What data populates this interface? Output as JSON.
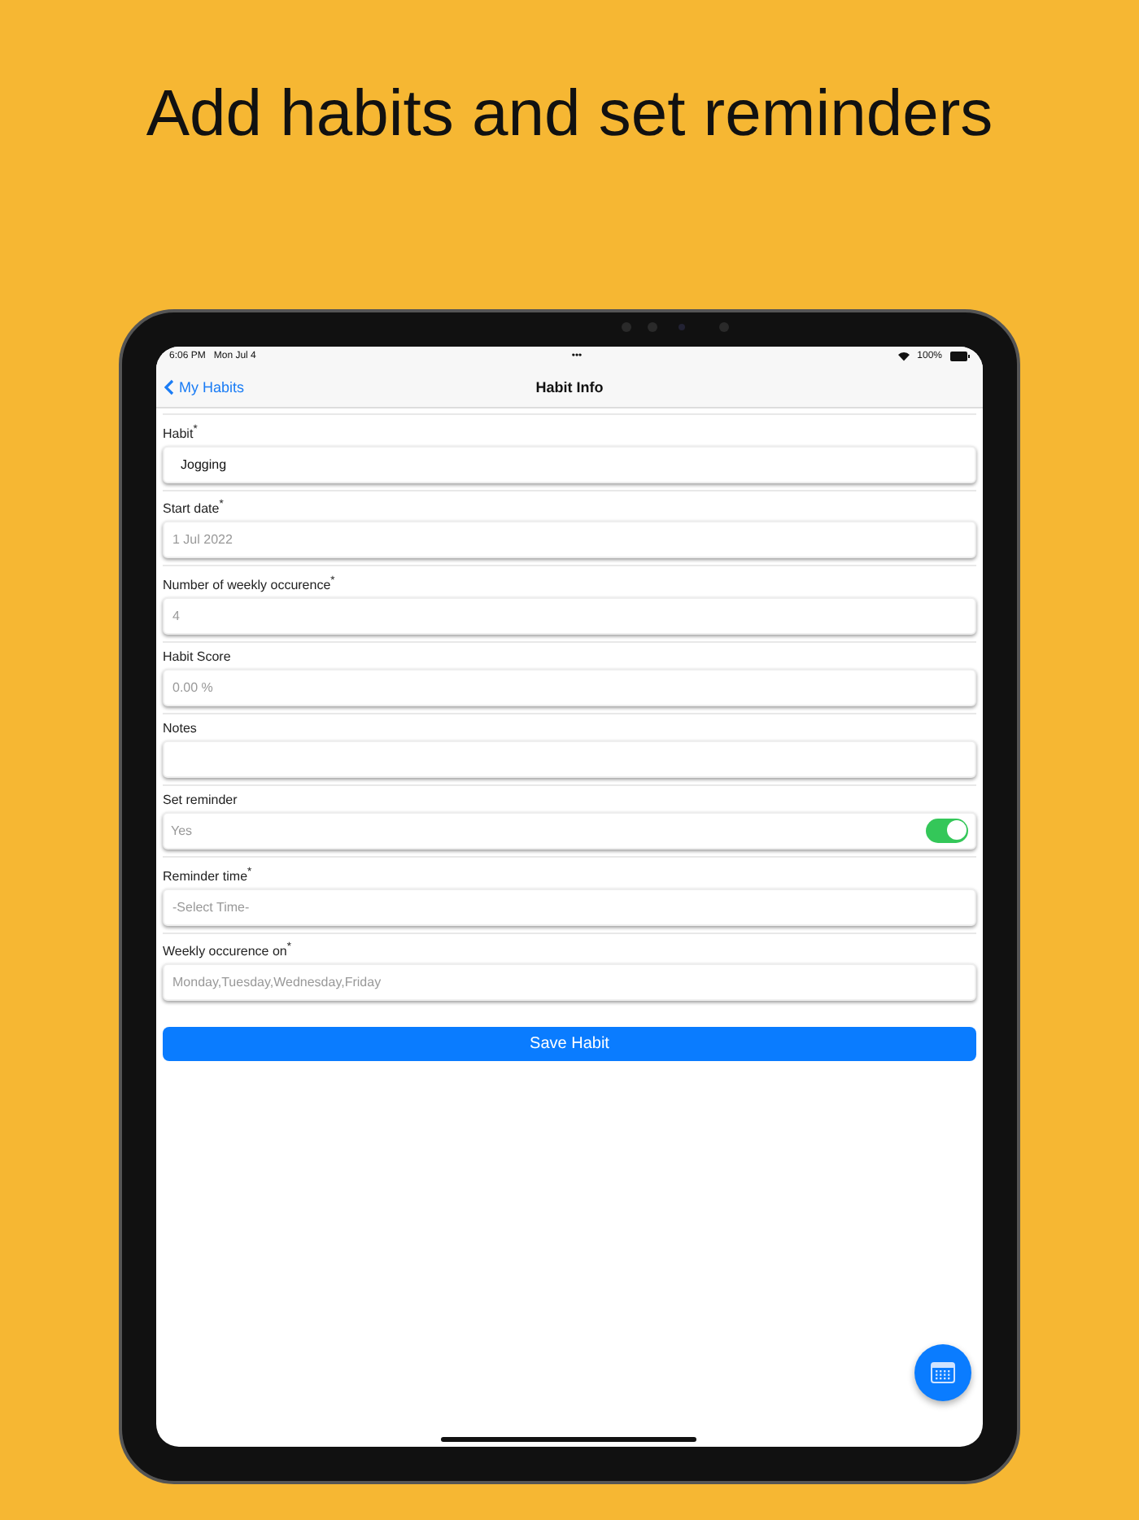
{
  "headline": "Add habits and set reminders",
  "status_bar": {
    "time": "6:06 PM",
    "date": "Mon Jul 4",
    "dots": "•••",
    "battery": "100%"
  },
  "nav": {
    "back": "My Habits",
    "title": "Habit Info"
  },
  "fields": [
    {
      "kind": "text",
      "label": "Habit$^{*}$",
      "value": "Jogging"
    },
    {
      "kind": "text",
      "label": "Start date$^{*}$",
      "placeholder": "1 Jul 2022"
    },
    {
      "kind": "text",
      "label": "Number of weekly occurence$^{*}$",
      "placeholder": "4"
    },
    {
      "kind": "text",
      "label": "Habit Score",
      "placeholder": "0.00 %"
    },
    {
      "kind": "text",
      "label": "Notes"
    },
    {
      "kind": "toggle",
      "label": "Set reminder",
      "text": "Yes",
      "on": true
    },
    {
      "kind": "text",
      "label": "Reminder time$^{*}$",
      "placeholder": "-Select Time-"
    },
    {
      "kind": "text",
      "label": "Weekly occurence on$^{*}$",
      "placeholder": "Monday,Tuesday,Wednesday,Friday"
    }
  ],
  "save_button": "Save Habit"
}
